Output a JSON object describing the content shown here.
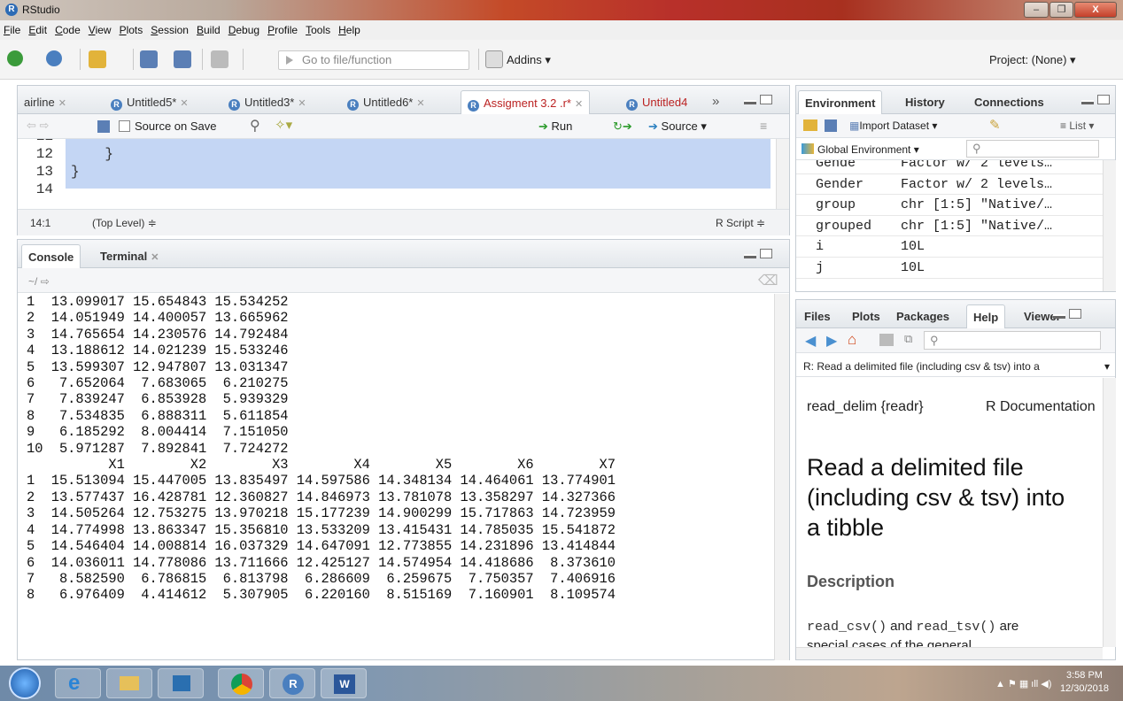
{
  "window": {
    "title": "RStudio",
    "buttons": [
      "–",
      "❐",
      "X"
    ]
  },
  "menu": [
    "File",
    "Edit",
    "Code",
    "View",
    "Plots",
    "Session",
    "Build",
    "Debug",
    "Profile",
    "Tools",
    "Help"
  ],
  "toolbar": {
    "goto_placeholder": "Go to file/function",
    "addins": "Addins ▾",
    "project": "Project: (None) ▾"
  },
  "editor": {
    "tabs": [
      {
        "label": "airline",
        "active": false
      },
      {
        "label": "Untitled5*",
        "active": false
      },
      {
        "label": "Untitled3*",
        "active": false
      },
      {
        "label": "Untitled6*",
        "active": false
      },
      {
        "label": "Assigment 3.2 .r*",
        "active": true
      },
      {
        "label": "Untitled4",
        "active": false
      }
    ],
    "overflow": "»",
    "source_on_save": "Source on Save",
    "run": "Run",
    "source": "Source",
    "lines": [
      {
        "n": "11",
        "code": ""
      },
      {
        "n": "12",
        "code": "    }"
      },
      {
        "n": "13",
        "code": "}"
      },
      {
        "n": "14",
        "code": ""
      }
    ],
    "status": {
      "position": "14:1",
      "scope": "(Top Level) ≑",
      "type": "R Script ≑"
    }
  },
  "console": {
    "tabs": [
      "Console",
      "Terminal"
    ],
    "path": "~/",
    "lines": [
      "1  13.099017 15.654843 15.534252",
      "2  14.051949 14.400057 13.665962",
      "3  14.765654 14.230576 14.792484",
      "4  13.188612 14.021239 15.533246",
      "5  13.599307 12.947807 13.031347",
      "6   7.652064  7.683065  6.210275",
      "7   7.839247  6.853928  5.939329",
      "8   7.534835  6.888311  5.611854",
      "9   6.185292  8.004414  7.151050",
      "10  5.971287  7.892841  7.724272",
      "          X1        X2        X3        X4        X5        X6        X7",
      "1  15.513094 15.447005 13.835497 14.597586 14.348134 14.464061 13.774901",
      "2  13.577437 16.428781 12.360827 14.846973 13.781078 13.358297 14.327366",
      "3  14.505264 12.753275 13.970218 15.177239 14.900299 15.717863 14.723959",
      "4  14.774998 13.863347 15.356810 13.533209 13.415431 14.785035 15.541872",
      "5  14.546404 14.008814 16.037329 14.647091 12.773855 14.231896 13.414844",
      "6  14.036011 14.778086 13.711666 12.425127 14.574954 14.418686  8.373610",
      "7   8.582590  6.786815  6.813798  6.286609  6.259675  7.750357  7.406916",
      "8   6.976409  4.414612  5.307905  6.220160  8.515169  7.160901  8.109574"
    ]
  },
  "environment": {
    "tabs": [
      "Environment",
      "History",
      "Connections"
    ],
    "import": "Import Dataset ▾",
    "list": "List ▾",
    "scope": "Global Environment ▾",
    "rows": [
      {
        "name": "Gende",
        "value": "Factor w/ 2 levels…"
      },
      {
        "name": "Gender",
        "value": "Factor w/ 2 levels…"
      },
      {
        "name": "group",
        "value": "chr [1:5] \"Native/…"
      },
      {
        "name": "grouped",
        "value": "chr [1:5] \"Native/…"
      },
      {
        "name": "i",
        "value": "10L"
      },
      {
        "name": "j",
        "value": "10L"
      }
    ]
  },
  "help": {
    "tabs": [
      "Files",
      "Plots",
      "Packages",
      "Help",
      "Viewer"
    ],
    "topic": "R: Read a delimited file (including csv & tsv) into a",
    "doc_left": "read_delim {readr}",
    "doc_right": "R Documentation",
    "heading": "Read a delimited file (including csv & tsv) into a tibble",
    "section": "Description",
    "code1": "read_csv()",
    "and": " and ",
    "code2": "read_tsv()",
    "are": " are",
    "cut": "special cases of the general"
  },
  "taskbar": {
    "time": "3:58 PM",
    "date": "12/30/2018"
  },
  "colors": {
    "accent": "#4a7fbf",
    "selection": "#c4d6f4",
    "pane_border": "#c6cdd4"
  }
}
